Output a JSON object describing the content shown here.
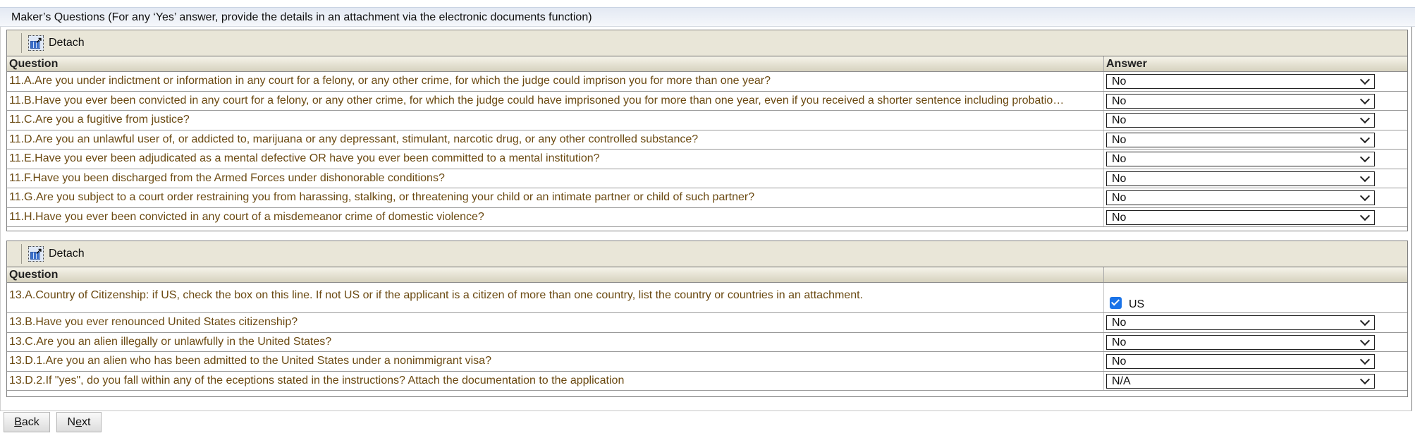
{
  "section": {
    "title": "Maker’s Questions (For any ‘Yes’ answer, provide the details in an attachment via the electronic documents function)"
  },
  "panel1": {
    "detach_label": "Detach",
    "headers": {
      "question": "Question",
      "answer": "Answer"
    },
    "rows": [
      {
        "question": "11.A.Are you under indictment or information in any court for a felony, or any other crime, for which the judge could imprison you for more than one year?",
        "answer": "No"
      },
      {
        "question": "11.B.Have you ever been convicted in any court for a felony, or any other crime, for which the judge could have imprisoned you for more than one year, even if you received a shorter sentence including probatio…",
        "answer": "No"
      },
      {
        "question": "11.C.Are you a fugitive from justice?",
        "answer": "No"
      },
      {
        "question": "11.D.Are you an unlawful user of, or addicted to, marijuana or any depressant, stimulant, narcotic drug, or any other controlled substance?",
        "answer": "No"
      },
      {
        "question": "11.E.Have you ever been adjudicated as a mental defective OR have you ever been committed to a mental institution?",
        "answer": "No"
      },
      {
        "question": "11.F.Have you been discharged from the Armed Forces under dishonorable conditions?",
        "answer": "No"
      },
      {
        "question": "11.G.Are you subject to a court order restraining you from harassing, stalking, or threatening your child or an intimate partner or child of such partner?",
        "answer": "No"
      },
      {
        "question": "11.H.Have you ever been convicted in any court of a misdemeanor crime of domestic violence?",
        "answer": "No"
      }
    ]
  },
  "panel2": {
    "detach_label": "Detach",
    "headers": {
      "question": "Question",
      "answer": ""
    },
    "citizenship": {
      "question": "13.A.Country of Citizenship: if US, check the box on this line. If not US or if the applicant is a citizen of more than one country, list the country or countries in an attachment.",
      "checkbox_label": "US",
      "checked": true
    },
    "rows": [
      {
        "question": "13.B.Have you ever renounced United States citizenship?",
        "answer": "No"
      },
      {
        "question": "13.C.Are you an alien illegally or unlawfully in the United States?",
        "answer": "No"
      },
      {
        "question": "13.D.1.Are you an alien who has been admitted to the United States under a nonimmigrant visa?",
        "answer": "No"
      },
      {
        "question": "13.D.2.If \"yes\", do you fall within any of the eceptions stated in the instructions? Attach the documentation to the application",
        "answer": "N/A"
      }
    ]
  },
  "footer": {
    "back_label": "Back",
    "back_accesskey": "B",
    "next_label": "Next",
    "next_accesskey": "e"
  }
}
